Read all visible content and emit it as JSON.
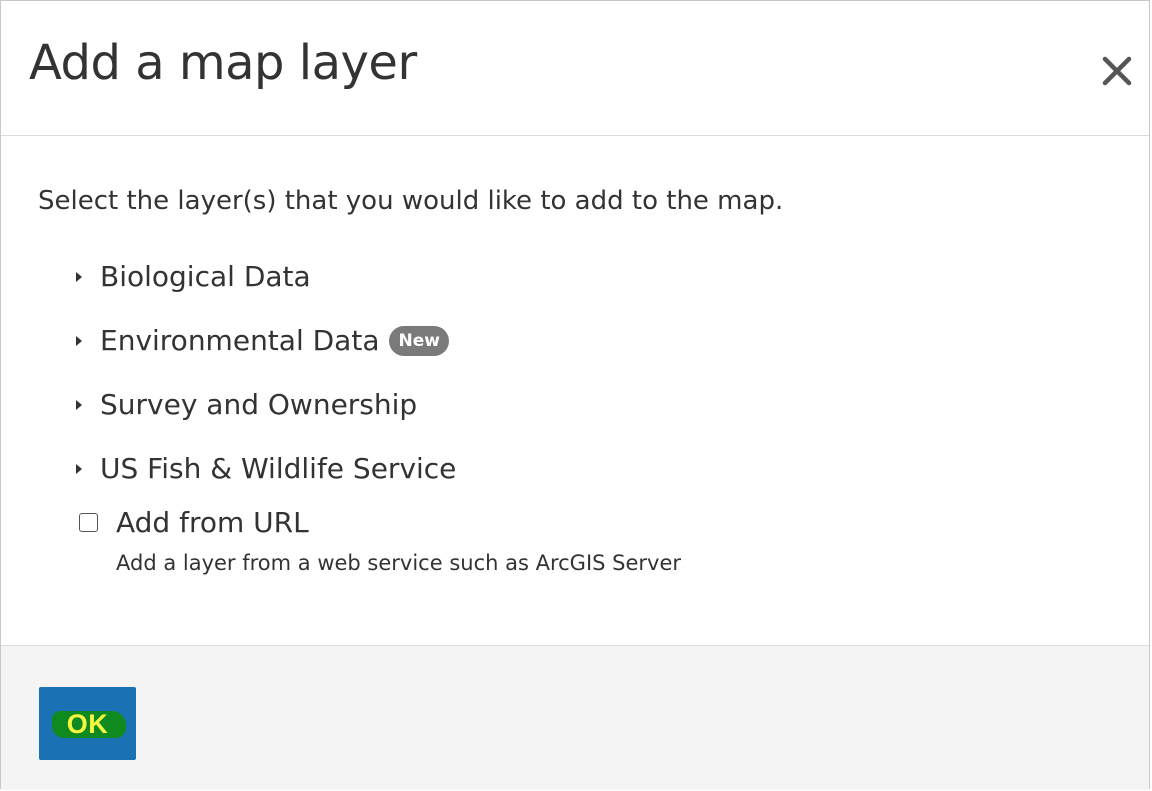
{
  "dialog": {
    "title": "Add a map layer",
    "close_icon": "close-icon"
  },
  "body": {
    "instructions": "Select the layer(s) that you would like to add to the map.",
    "layers": [
      {
        "label": "Biological Data",
        "badge": ""
      },
      {
        "label": "Environmental Data",
        "badge": "New"
      },
      {
        "label": "Survey and Ownership",
        "badge": ""
      },
      {
        "label": "US Fish & Wildlife Service",
        "badge": ""
      }
    ],
    "add_from_url": {
      "label": "Add from URL",
      "help": "Add a layer from a web service such as ArcGIS Server",
      "checked": false
    }
  },
  "footer": {
    "ok_label": "OK"
  },
  "colors": {
    "ok_button": "#1a72b5",
    "ok_highlight": "#0f8a1e",
    "ok_text": "#f5f542",
    "badge": "#7a7a7a",
    "footer_bg": "#f4f4f4"
  }
}
